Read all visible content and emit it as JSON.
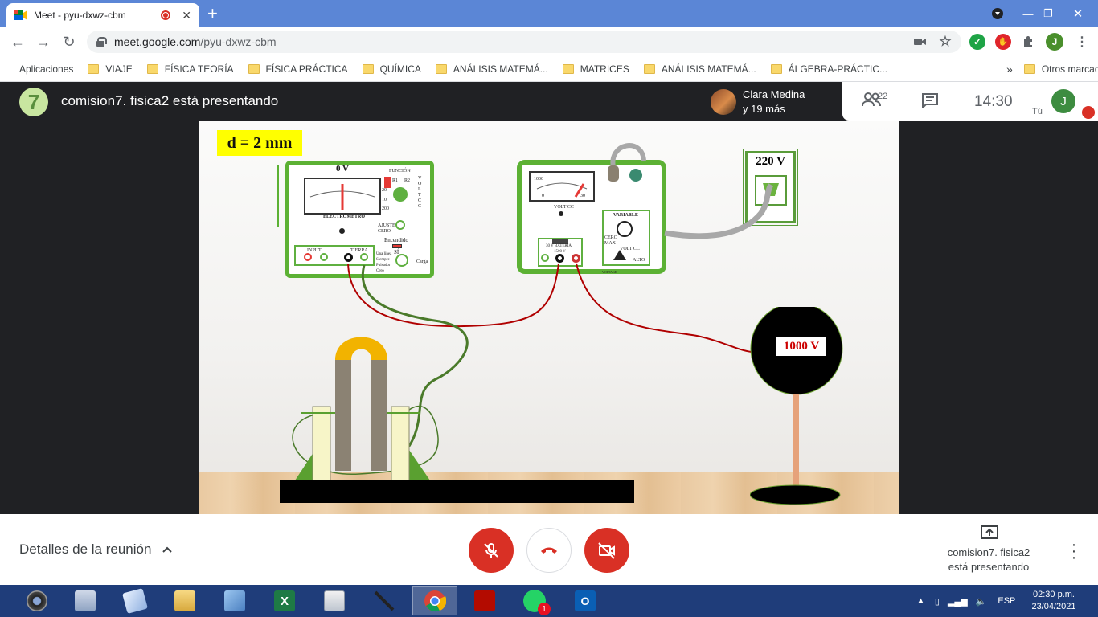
{
  "browser": {
    "tab_title": "Meet - pyu-dxwz-cbm",
    "url_host": "meet.google.com",
    "url_path": "/pyu-dxwz-cbm",
    "new_tab_symbol": "+",
    "window_controls": [
      "minimize-icon",
      "restore-icon",
      "close-icon"
    ],
    "extensions": [
      "camera-icon",
      "star-icon",
      "check-extension-icon",
      "stop-hand-extension-icon",
      "puzzle-icon"
    ],
    "profile_initial": "J"
  },
  "bookmarks": {
    "apps_label": "Aplicaciones",
    "items": [
      "VIAJE",
      "FÍSICA TEORÍA",
      "FÍSICA PRÁCTICA",
      "QUÍMICA",
      "ANÁLISIS MATEMÁ...",
      "MATRICES",
      "ANÁLISIS MATEMÁ...",
      "ÁLGEBRA-PRÁCTIC..."
    ],
    "overflow": "»",
    "other": "Otros marcadores"
  },
  "meet": {
    "presenter_initial": "7",
    "presenting_title": "comision7. fisica2 está presentando",
    "viewer_name": "Clara Medina",
    "viewer_more": "y 19 más",
    "participants_count": "22",
    "time": "14:30",
    "self_label": "Tú",
    "self_initial": "J",
    "details_label": "Detalles de la reunión",
    "presenting_info_line1": "comision7. fisica2",
    "presenting_info_line2": "está presentando"
  },
  "simulation": {
    "distance_label": "d = 2 mm",
    "electrometer": {
      "reading": "0 V",
      "name": "ELECTRÓMETRO",
      "funcion": "FUNCIÓN",
      "r1": "R1",
      "r2": "R2",
      "volt_cc": "VOLT CC",
      "ajuste": "AJUSTE",
      "cero": "CERO",
      "encendido": "Encendido",
      "si": "SÍ",
      "input": "INPUT",
      "tierra": "TIERRA",
      "carga": "Carga",
      "scale_20": "20",
      "scale_10": "10",
      "scale_200": "200",
      "side_options": "Una línea Siempre Pulsador Cero"
    },
    "power_supply": {
      "scale_left": "0",
      "scale_right": "30",
      "scale_top": "1000",
      "volt_cc": "VOLT CC",
      "variable": "VARIABLE",
      "cero": "CERO",
      "max": "MAX",
      "volt_cc2": "VOLT CC",
      "alto": "ALTO",
      "output_labels": "30 V  BATERÍA",
      "output_value": "1500 V",
      "voltage": "VOLTAGE"
    },
    "outlet_label": "220 V",
    "sphere_label": "1000 V"
  },
  "taskbar": {
    "apps": [
      "webcam-app-icon",
      "calculator-icon",
      "notes-icon",
      "file-explorer-icon",
      "control-panel-icon",
      "excel-icon",
      "presentation-icon",
      "pen-tool-icon",
      "chrome-icon",
      "acrobat-icon",
      "whatsapp-icon",
      "outlook-icon"
    ],
    "whatsapp_badge": "1",
    "language": "ESP",
    "clock_time": "02:30 p.m.",
    "clock_date": "23/04/2021"
  },
  "colors": {
    "tab_bar": "#5b86d6",
    "panel_green": "#5cb134",
    "meet_red": "#d93025",
    "taskbar": "#1f3d7a",
    "label_yellow": "#ffff00",
    "wire_red": "#b00000",
    "wire_green": "#4a7a2a"
  }
}
